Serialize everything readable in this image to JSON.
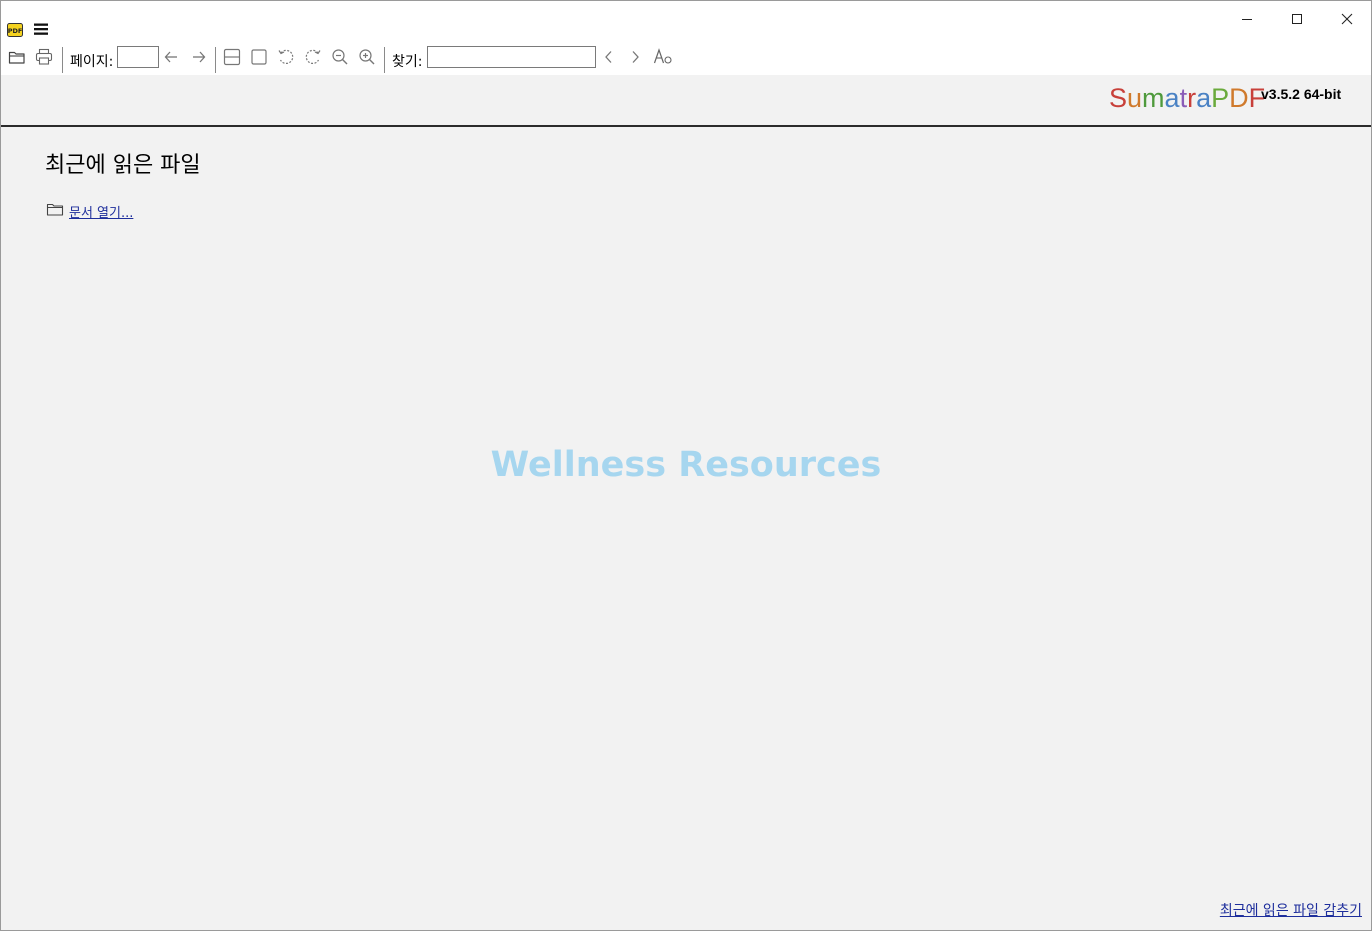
{
  "titlebar": {
    "app_icon": "sumatra-pdf-app-icon",
    "menu_icon": "hamburger-menu-icon",
    "app_icon_text": "PDF",
    "controls": [
      "minimize-icon",
      "maximize-icon",
      "close-icon"
    ]
  },
  "toolbar": {
    "open_icon": "folder-open-icon",
    "print_icon": "printer-icon",
    "page_label": "페이지:",
    "page_value": "",
    "prev_page_icon": "arrow-left-icon",
    "next_page_icon": "arrow-right-icon",
    "fit_width_icon": "fit-width-icon",
    "fit_page_icon": "fit-page-icon",
    "rotate_left_icon": "rotate-left-icon",
    "rotate_right_icon": "rotate-right-icon",
    "zoom_out_icon": "zoom-out-icon",
    "zoom_in_icon": "zoom-in-icon",
    "find_label": "찾기:",
    "find_value": "",
    "find_prev_icon": "chevron-left-icon",
    "find_next_icon": "chevron-right-icon",
    "match_case_icon": "match-case-icon"
  },
  "brand": {
    "letters": [
      {
        "ch": "S",
        "color": "#c8403a"
      },
      {
        "ch": "u",
        "color": "#d07a2c"
      },
      {
        "ch": "m",
        "color": "#4f9a3c"
      },
      {
        "ch": "a",
        "color": "#4a82c4"
      },
      {
        "ch": "t",
        "color": "#8a5cb8"
      },
      {
        "ch": "r",
        "color": "#c8403a"
      },
      {
        "ch": "a",
        "color": "#4a82c4"
      },
      {
        "ch": "P",
        "color": "#6aaa3c"
      },
      {
        "ch": "D",
        "color": "#d07a2c"
      },
      {
        "ch": "F",
        "color": "#c8403a"
      }
    ],
    "version": "v3.5.2 64-bit"
  },
  "home": {
    "recent_title": "최근에 읽은 파일",
    "open_link": "문서 열기...",
    "open_icon": "folder-icon",
    "watermark": "Wellness Resources",
    "hide_recent": "최근에 읽은 파일 감추기"
  },
  "colors": {
    "link": "#1e2e9c",
    "content_bg": "#f2f2f2",
    "watermark": "#a6d6ef"
  }
}
